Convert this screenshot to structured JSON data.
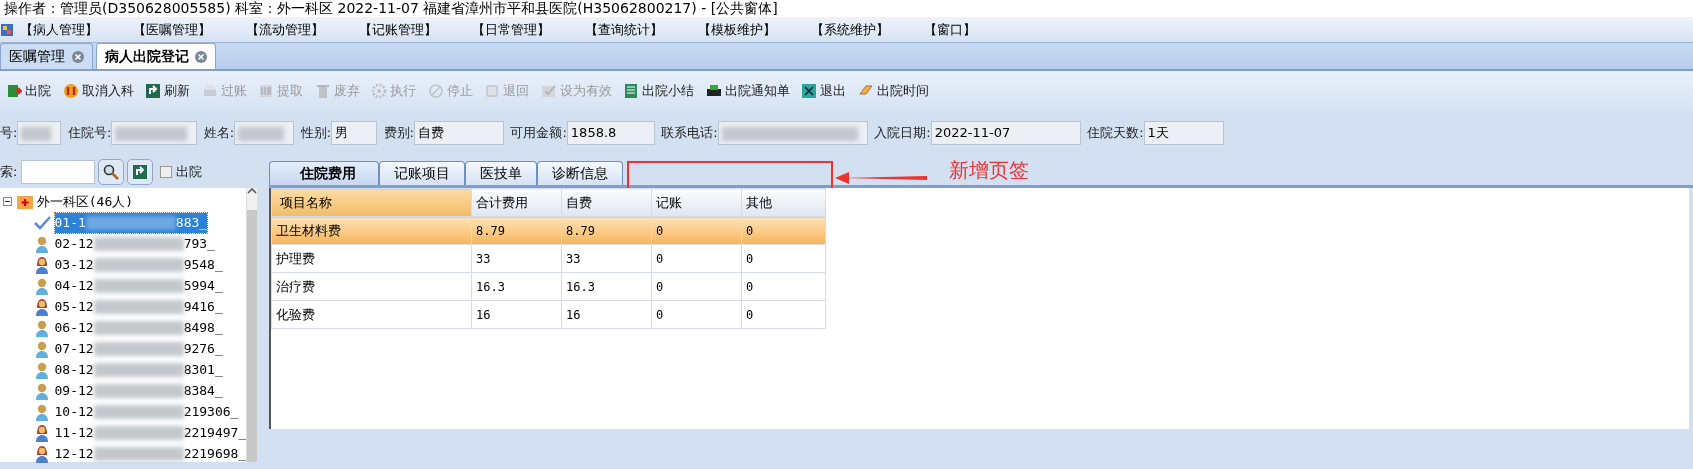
{
  "window": {
    "title": "操作者：管理员(D350628005585) 科室：外一科区 2022-11-07 福建省漳州市平和县医院(H35062800217) - [公共窗体]"
  },
  "menu": [
    "【病人管理】",
    "【医嘱管理】",
    "【流动管理】",
    "【记账管理】",
    "【日常管理】",
    "【查询统计】",
    "【模板维护】",
    "【系统维护】",
    "【窗口】"
  ],
  "doc_tabs": [
    {
      "label": "医嘱管理",
      "selected": false
    },
    {
      "label": "病人出院登记",
      "selected": true
    }
  ],
  "toolbar": [
    {
      "label": "出院",
      "disabled": false
    },
    {
      "label": "取消入科",
      "disabled": false
    },
    {
      "label": "刷新",
      "disabled": false
    },
    {
      "label": "过账",
      "disabled": true
    },
    {
      "label": "提取",
      "disabled": true
    },
    {
      "label": "废弃",
      "disabled": true
    },
    {
      "label": "执行",
      "disabled": true
    },
    {
      "label": "停止",
      "disabled": true
    },
    {
      "label": "退回",
      "disabled": true
    },
    {
      "label": "设为有效",
      "disabled": true
    },
    {
      "label": "出院小结",
      "disabled": false
    },
    {
      "label": "出院通知单",
      "disabled": false
    },
    {
      "label": "退出",
      "disabled": false
    },
    {
      "label": "出院时间",
      "disabled": false
    }
  ],
  "patient_fields": [
    {
      "label": "号:",
      "redacted": true
    },
    {
      "label": "住院号:",
      "redacted": true
    },
    {
      "label": "姓名:",
      "redacted": true
    },
    {
      "label": "性别:",
      "value": "男",
      "redacted": false
    },
    {
      "label": "费别:",
      "value": "自费",
      "redacted": false
    },
    {
      "label": "可用金额:",
      "value": "1858.8",
      "redacted": false
    },
    {
      "label": "联系电话:",
      "redacted": true
    },
    {
      "label": "入院日期:",
      "value": "2022-11-07",
      "redacted": false
    },
    {
      "label": "住院天数:",
      "value": "1天",
      "redacted": false
    }
  ],
  "search": {
    "label": "索:",
    "checkbox_label": "出院",
    "checked": false
  },
  "tree": {
    "label": "外一科区(46人)",
    "expanded": true,
    "children": [
      {
        "kind": "checked",
        "prefix": "01-1",
        "suffix": "883_",
        "selected": true
      },
      {
        "kind": "male",
        "prefix": "02-12",
        "suffix": "793_",
        "selected": false
      },
      {
        "kind": "female",
        "prefix": "03-12",
        "suffix": "9548_",
        "selected": false
      },
      {
        "kind": "male",
        "prefix": "04-12",
        "suffix": "5994_",
        "selected": false
      },
      {
        "kind": "female",
        "prefix": "05-12",
        "suffix": "9416_",
        "selected": false
      },
      {
        "kind": "male",
        "prefix": "06-12",
        "suffix": "8498_",
        "selected": false
      },
      {
        "kind": "male",
        "prefix": "07-12",
        "suffix": "9276_",
        "selected": false
      },
      {
        "kind": "male",
        "prefix": "08-12",
        "suffix": "8301_",
        "selected": false
      },
      {
        "kind": "male",
        "prefix": "09-12",
        "suffix": "8384_",
        "selected": false
      },
      {
        "kind": "male",
        "prefix": "10-12",
        "suffix": "219306_",
        "selected": false
      },
      {
        "kind": "female",
        "prefix": "11-12",
        "suffix": "2219497_",
        "selected": false
      },
      {
        "kind": "female",
        "prefix": "12-12",
        "suffix": "2219698_",
        "selected": false
      }
    ]
  },
  "tabs": [
    {
      "label": "住院费用",
      "selected": true
    },
    {
      "label": "记账项目",
      "selected": false
    },
    {
      "label": "医技单",
      "selected": false
    },
    {
      "label": "诊断信息",
      "selected": false
    }
  ],
  "annotation": {
    "text": "新增页签"
  },
  "table": {
    "columns": [
      "项目名称",
      "合计费用",
      "自费",
      "记账",
      "其他"
    ],
    "rows": [
      {
        "cells": [
          "卫生材料费",
          "8.79",
          "8.79",
          "0",
          "0"
        ],
        "selected": true
      },
      {
        "cells": [
          "护理费",
          "33",
          "33",
          "0",
          "0"
        ],
        "selected": false
      },
      {
        "cells": [
          "治疗费",
          "16.3",
          "16.3",
          "0",
          "0"
        ],
        "selected": false
      },
      {
        "cells": [
          "化验费",
          "16",
          "16",
          "0",
          "0"
        ],
        "selected": false
      }
    ]
  }
}
